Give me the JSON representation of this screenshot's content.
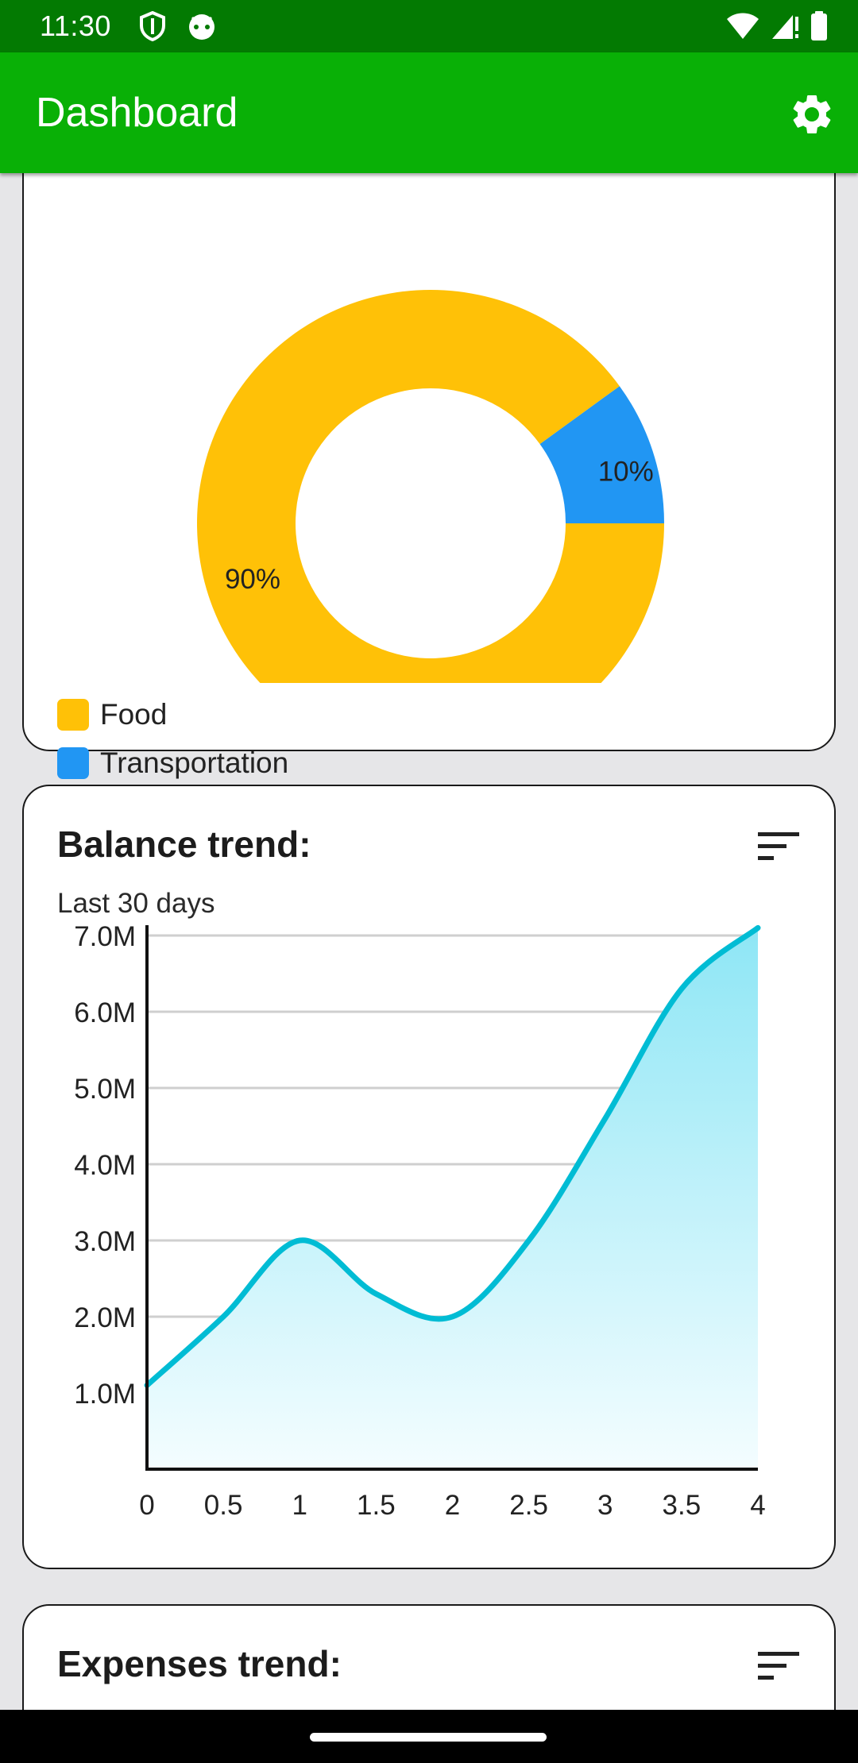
{
  "status_bar": {
    "time": "11:30",
    "left_icons": [
      "shield-icon",
      "android-icon"
    ],
    "right_icons": [
      "wifi-icon",
      "signal-icon",
      "battery-icon"
    ]
  },
  "app_bar": {
    "title": "Dashboard",
    "settings_icon": "gear-icon",
    "background": "#09b006"
  },
  "expenses_card": {
    "legend": [
      {
        "label": "Food",
        "color": "#ffc107"
      },
      {
        "label": "Transportation",
        "color": "#2196f3"
      }
    ],
    "chart_data": {
      "type": "pie",
      "style": "donut",
      "slices": [
        {
          "name": "Food",
          "value": 90,
          "label": "90%",
          "color": "#ffc107"
        },
        {
          "name": "Transportation",
          "value": 10,
          "label": "10%",
          "color": "#2196f3"
        }
      ]
    }
  },
  "balance_card": {
    "title": "Balance trend:",
    "subtitle": "Last 30 days",
    "sort_icon": "sort-icon",
    "chart_data": {
      "type": "area",
      "x": [
        0,
        0.5,
        1,
        1.5,
        2,
        2.5,
        3,
        3.5,
        4
      ],
      "series": [
        {
          "values": [
            1.1,
            2.0,
            3.0,
            2.3,
            2.0,
            3.0,
            4.6,
            6.3,
            7.1
          ],
          "color": "#00bcd4"
        }
      ],
      "x_ticks": [
        "0",
        "0.5",
        "1",
        "1.5",
        "2",
        "2.5",
        "3",
        "3.5",
        "4"
      ],
      "y_ticks": [
        "1.0M",
        "2.0M",
        "3.0M",
        "4.0M",
        "5.0M",
        "6.0M",
        "7.0M"
      ],
      "xlim": [
        0,
        4
      ],
      "ylim": [
        0,
        7
      ],
      "grid": true
    }
  },
  "expenses_trend_card": {
    "title": "Expenses trend:",
    "sort_icon": "sort-icon"
  }
}
